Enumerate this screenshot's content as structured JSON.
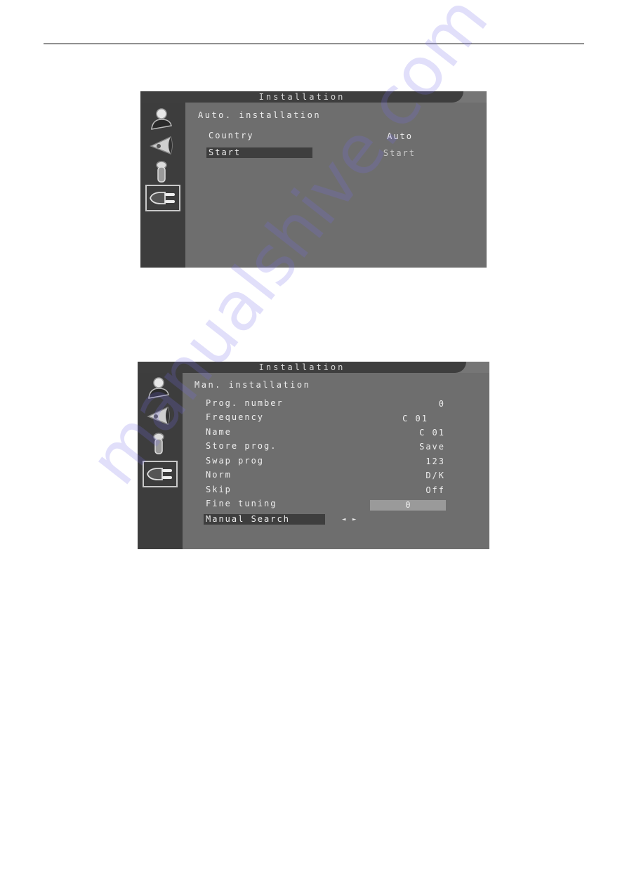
{
  "watermark": "manualshive.com",
  "panels": [
    {
      "title": "Installation",
      "section": "Auto. installation",
      "sidebar_icons": [
        "user-icon",
        "speaker-icon",
        "remote-icon",
        "plug-icon"
      ],
      "active_icon": "plug-icon",
      "rows": [
        {
          "label": "Country",
          "value": "Auto",
          "selected": false
        },
        {
          "label": "Start",
          "value": "Start",
          "selected": true
        }
      ]
    },
    {
      "title": "Installation",
      "section": "Man. installation",
      "sidebar_icons": [
        "user-icon",
        "speaker-icon",
        "remote-icon",
        "plug-icon"
      ],
      "active_icon": "plug-icon",
      "rows": [
        {
          "label": "Prog. number",
          "value": "0"
        },
        {
          "label": "Frequency",
          "value": "C 01"
        },
        {
          "label": "Name",
          "value": "C 01"
        },
        {
          "label": "Store prog.",
          "value": "Save"
        },
        {
          "label": "Swap prog",
          "value": "123"
        },
        {
          "label": "Norm",
          "value": "D/K"
        },
        {
          "label": "Skip",
          "value": "Off"
        },
        {
          "label": "Fine tuning",
          "value": "0"
        },
        {
          "label": "Manual Search",
          "value": "◄ ►",
          "selected": true
        }
      ]
    }
  ],
  "colors": {
    "osd_background": "#6e6e6e",
    "sidebar": "#3d3d3d",
    "selection": "#3e3e3e",
    "slider": "#9a9a9a",
    "text": "#eeeeee"
  }
}
